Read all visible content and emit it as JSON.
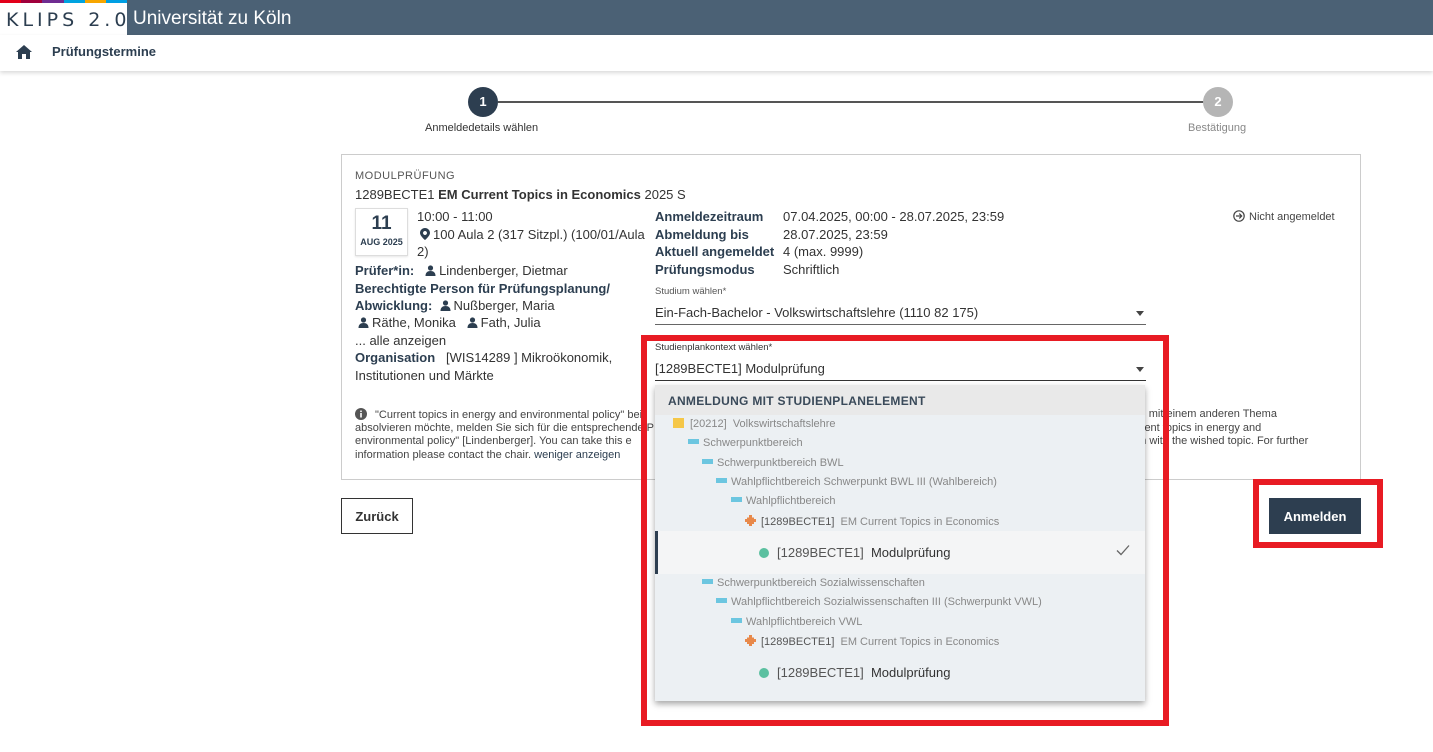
{
  "header": {
    "logo": "KLIPS 2.0",
    "university": "Universität zu Köln",
    "strip_colors": [
      "#e2001a",
      "#a0003c",
      "#6f2c91",
      "#00a3e0",
      "#f7a600",
      "#009fe3"
    ]
  },
  "nav": {
    "title": "Prüfungstermine"
  },
  "stepper": {
    "steps": [
      {
        "num": "1",
        "label": "Anmeldedetails wählen"
      },
      {
        "num": "2",
        "label": "Bestätigung"
      }
    ]
  },
  "exam": {
    "kind": "MODULPRÜFUNG",
    "code": "1289BECTE1",
    "title": "EM Current Topics in Economics",
    "semester": "2025 S",
    "date_day": "11",
    "date_month": "AUG 2025",
    "time": "10:00 - 11:00",
    "room_line1": "100 Aula 2 (317 Sitzpl.) (100/01/Aula",
    "room_line2": "2)",
    "examiner_label": "Prüfer*in:",
    "examiner": "Lindenberger, Dietmar",
    "authorized_label1": "Berechtigte Person für Prüfungsplanung/",
    "authorized_label2": "Abwicklung:",
    "authorized1": "Nußberger, Maria",
    "authorized2": "Räthe, Monika",
    "authorized3": "Fath, Julia",
    "show_all": "... alle anzeigen",
    "org_label": "Organisation",
    "org_value1": "[WIS14289 ] Mikroökonomik,",
    "org_value2": "Institutionen und Märkte",
    "reg_period_label": "Anmeldezeitraum",
    "reg_period": "07.04.2025, 00:00 - 28.07.2025, 23:59",
    "dereg_label": "Abmeldung bis",
    "dereg": "28.07.2025, 23:59",
    "current_label": "Aktuell angemeldet",
    "current": "4 (max. 9999)",
    "mode_label": "Prüfungsmodus",
    "mode": "Schriftlich",
    "status": "Nicht angemeldet",
    "study_label": "Studium wählen*",
    "study_value": "Ein-Fach-Bachelor - Volkswirtschaftslehre (1110 82 175)",
    "context_label": "Studienplankontext wählen*",
    "context_value": "[1289BECTE1]  Modulprüfung",
    "info_line1_left": "\"Current topics in energy and environmental policy\" bei",
    "info_line1_right": "dul mit einem anderen Thema",
    "info_line2_left": "absolvieren möchte, melden Sie sich für die entsprechende P",
    "info_line2_right": "urrent topics in energy and",
    "info_line3_left": "environmental policy\" [Lindenberger].  You can take this e",
    "info_line3_right": "am with the wished topic. For further",
    "info_line4": "information please contact the chair.",
    "show_less": "weniger anzeigen"
  },
  "buttons": {
    "back": "Zurück",
    "register": "Anmelden"
  },
  "dropdown": {
    "header": "ANMELDUNG MIT STUDIENPLANELEMENT",
    "tree1": {
      "root_code": "[20212]",
      "root_name": "Volkswirtschaftslehre",
      "l1": "Schwerpunktbereich",
      "l2": "Schwerpunktbereich BWL",
      "l3": "Wahlpflichtbereich Schwerpunkt BWL III (Wahlbereich)",
      "l4": "Wahlpflichtbereich",
      "module_code": "[1289BECTE1]",
      "module_name": "EM Current Topics in Economics",
      "exam_code": "[1289BECTE1]",
      "exam_name": "Modulprüfung"
    },
    "tree2": {
      "l2": "Schwerpunktbereich Sozialwissenschaften",
      "l3": "Wahlpflichtbereich Sozialwissenschaften III (Schwerpunkt VWL)",
      "l4": "Wahlpflichtbereich VWL",
      "module_code": "[1289BECTE1]",
      "module_name": "EM Current Topics in Economics",
      "exam_code": "[1289BECTE1]",
      "exam_name": "Modulprüfung"
    }
  }
}
